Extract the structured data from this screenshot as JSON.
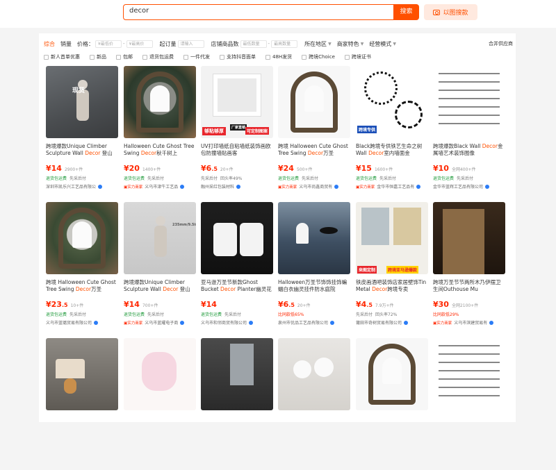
{
  "search": {
    "query": "decor",
    "button": "搜索",
    "image_search": "以图搜款"
  },
  "filters": {
    "sort": [
      "综合",
      "销量"
    ],
    "price_label": "价格：",
    "price_min": "¥最低价",
    "price_max": "¥最高价",
    "moq_label": "起订量",
    "moq_placeholder": "请输入",
    "shop_years_label": "店铺商品数",
    "shop_min": "最低数量",
    "shop_max": "最高数量",
    "location": "所在地区",
    "merchant": "商家特色",
    "model": "经营模式",
    "supplier": "合并供应商",
    "checks": [
      "新人首单优惠",
      "新品",
      "包邮",
      "退货包运费",
      "一件代发",
      "支持抖音面单",
      "48H发货",
      "跨境Choice",
      "跨境证书"
    ]
  },
  "products": [
    {
      "title_a": "跨境爆款Unique Climber Sculpture Wall ",
      "kw": "Decor",
      "title_b": " 登山",
      "price": "14",
      "dec": "",
      "sold": "2900+件",
      "tags": [
        "退货包运费",
        "先采后付"
      ],
      "shop": "深圳市凯乐兴工艺品有限公",
      "badge": ""
    },
    {
      "title_a": "Halloween Cute Ghost Tree Swing ",
      "kw": "Decor",
      "title_b": "秋千树上",
      "price": "20",
      "dec": "",
      "sold": "1400+件",
      "tags": [
        "退货包运费",
        "先采后付"
      ],
      "shop": "义乌市津牛工艺品",
      "badge": "实力商家"
    },
    {
      "title_a": "UV打印墙纸自粘墙纸装饰画欧包防撞墙贴画客",
      "kw": "",
      "title_b": "",
      "price": "6",
      "dec": ".5",
      "sold": "20+件",
      "tags": [
        "先采后付",
        "回头率49%"
      ],
      "shop": "融州采红包装材料",
      "badge": ""
    },
    {
      "title_a": "跨境 Halloween Cute Ghost Tree Swing ",
      "kw": "Decor",
      "title_b": "万圣",
      "price": "24",
      "dec": "",
      "sold": "500+件",
      "tags": [
        "退货包运费",
        "先采后付"
      ],
      "shop": "义乌市尚鑫商贸有",
      "badge": "实力商家"
    },
    {
      "title_a": "Black跨境专供铁艺生命之树 Wall ",
      "kw": "Decor",
      "title_b": "室内墙面金",
      "price": "15",
      "dec": "",
      "sold": "1600+件",
      "tags": [
        "退货包运费",
        "先采后付"
      ],
      "shop": "金华市恒嘉工艺品有",
      "badge": "实力商家"
    },
    {
      "title_a": "跨境爆款Black Wall ",
      "kw": "Decor",
      "title_b": "金属墙艺术装饰图像",
      "price": "10",
      "dec": "",
      "sold": "全网400+件",
      "tags": [
        "退货包运费",
        "先采后付"
      ],
      "shop": "金华市蓝辉工艺品有限公司",
      "badge": ""
    },
    {
      "title_a": "跨境 Halloween Cute Ghost Tree Swing ",
      "kw": "Decor",
      "title_b": "万圣",
      "price": "23",
      "dec": ".5",
      "sold": "10+件",
      "tags": [
        "退货包运费",
        "先采后付"
      ],
      "shop": "义乌市蓝璐贸易有限公司",
      "badge": ""
    },
    {
      "title_a": "跨境爆款Unique Climber Sculpture Wall ",
      "kw": "Decor",
      "title_b": " 登山",
      "price": "14",
      "dec": "",
      "sold": "700+件",
      "tags": [
        "退货包运费",
        "先采后付"
      ],
      "shop": "义乌市蓝耀电子商",
      "badge": "实力商家"
    },
    {
      "title_a": "亚马逊万圣节新款Ghost Bucket ",
      "kw": "Decor",
      "title_b": " Planter幽灵花",
      "price": "14",
      "dec": "",
      "sold": "",
      "tags": [
        "退货包运费",
        "先采后付"
      ],
      "shop": "义乌市和邻商贸有限公司",
      "badge": ""
    },
    {
      "title_a": "Halloween万圣节饰饰挂饰蝙蝠白衣幽灵挂件防水庭院",
      "kw": "",
      "title_b": "",
      "price": "6",
      "dec": ".5",
      "sold": "20+件",
      "tags": [
        "比同款低65%"
      ],
      "shop": "泉州市优品工艺品有限公司",
      "badge": ""
    },
    {
      "title_a": "铁皮画酒吧装饰店家居壁饰Tin Metal ",
      "kw": "Decor",
      "title_b": "跨境专卖",
      "price": "4",
      "dec": ".5",
      "sold": "7.9万+件",
      "tags": [
        "先采后付",
        "回头率72%"
      ],
      "shop": "莆田市奇树贸易有限公司",
      "badge": ""
    },
    {
      "title_a": "跨境万圣节节两所木乃伊摆卫生间Outhouse Mu",
      "kw": "",
      "title_b": "",
      "price": "30",
      "dec": "",
      "sold": "全网2100+件",
      "tags": [
        "比同款低29%"
      ],
      "shop": "义乌市滨建贸易有",
      "badge": "实力商家"
    },
    {
      "title_a": "",
      "kw": "",
      "title_b": "",
      "price": "",
      "dec": "",
      "sold": "",
      "tags": [],
      "shop": "",
      "badge": ""
    },
    {
      "title_a": "",
      "kw": "",
      "title_b": "",
      "price": "",
      "dec": "",
      "sold": "",
      "tags": [],
      "shop": "",
      "badge": ""
    },
    {
      "title_a": "",
      "kw": "",
      "title_b": "",
      "price": "",
      "dec": "",
      "sold": "",
      "tags": [],
      "shop": "",
      "badge": ""
    },
    {
      "title_a": "",
      "kw": "",
      "title_b": "",
      "price": "",
      "dec": "",
      "sold": "",
      "tags": [],
      "shop": "",
      "badge": ""
    },
    {
      "title_a": "",
      "kw": "",
      "title_b": "",
      "price": "",
      "dec": "",
      "sold": "",
      "tags": [],
      "shop": "",
      "badge": ""
    },
    {
      "title_a": "",
      "kw": "",
      "title_b": "",
      "price": "",
      "dec": "",
      "sold": "",
      "tags": [],
      "shop": "",
      "badge": ""
    }
  ],
  "overlays": {
    "now_stock": "现货",
    "sticky": "够粘够厚",
    "factory": "厂家直销",
    "custom": "可定制图案",
    "cross": "跨境专供",
    "custom2": "来图定制",
    "cross2": "跨境亚马逊爆款",
    "size": "235mm/9.5inch"
  },
  "colors": {
    "accent": "#ff5000",
    "price": "#ff2700"
  }
}
